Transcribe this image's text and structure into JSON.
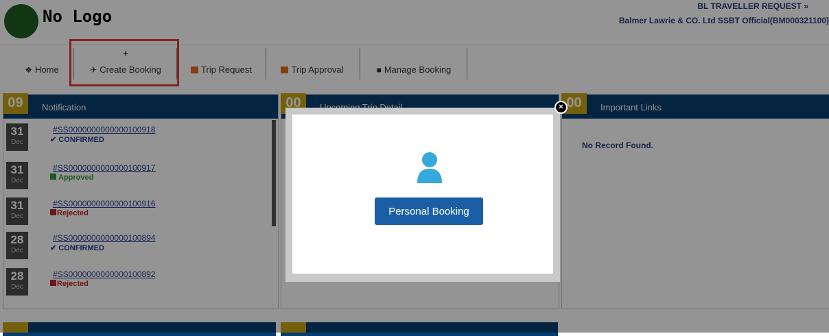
{
  "header": {
    "logo_text": "No Logo",
    "user_title": "BL TRAVELLER REQUEST »",
    "user_org": "Balmer Lawrie & CO. Ltd SSBT Official(BM000321100)"
  },
  "nav": {
    "plus": "+",
    "home": "Home",
    "create_booking": "Create Booking",
    "trip_request": "Trip Request",
    "trip_approval": "Trip Approval",
    "manage_booking": "Manage Booking"
  },
  "notification": {
    "count": "09",
    "title": "Notification",
    "items": [
      {
        "day": "31",
        "month": "Dec",
        "id": "#SS0000000000000100918",
        "status": "CONFIRMED"
      },
      {
        "day": "31",
        "month": "Dec",
        "id": "#SS0000000000000100917",
        "status": "Approved"
      },
      {
        "day": "31",
        "month": "Dec",
        "id": "#SS0000000000000100916",
        "status": "Rejected"
      },
      {
        "day": "28",
        "month": "Dec",
        "id": "#SS0000000000000100894",
        "status": "CONFIRMED"
      },
      {
        "day": "28",
        "month": "Dec",
        "id": "#SS0000000000000100892",
        "status": "Rejected"
      }
    ]
  },
  "upcoming": {
    "count": "00",
    "title": "Upcoming Trip Detail"
  },
  "links": {
    "count": "00",
    "title": "Important Links",
    "empty": "No Record Found."
  },
  "modal": {
    "button_label": "Personal Booking",
    "close_symbol": "×",
    "icon": "user-icon"
  },
  "colors": {
    "panel_header": "#073e72",
    "count_badge": "#c9a514",
    "confirmed": "#2a3f8f",
    "approved": "#2e9b3a",
    "rejected": "#c0272d",
    "button": "#1a5fa6",
    "user_icon": "#35a8dc",
    "highlight": "#e53935"
  }
}
